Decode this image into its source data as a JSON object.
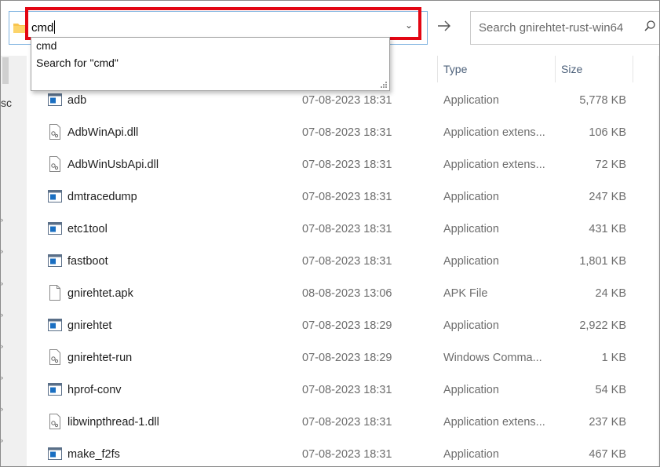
{
  "address_bar": {
    "value": "cmd"
  },
  "search": {
    "placeholder": "Search gnirehtet-rust-win64"
  },
  "suggestions": [
    {
      "label": "cmd"
    },
    {
      "label": "Search for \"cmd\""
    }
  ],
  "nav_pane": {
    "partial_label": "sc"
  },
  "columns": {
    "type": "Type",
    "size": "Size"
  },
  "files": [
    {
      "name": "adb",
      "date": "07-08-2023 18:31",
      "type": "Application",
      "size": "5,778 KB",
      "icon": "application-icon"
    },
    {
      "name": "AdbWinApi.dll",
      "date": "07-08-2023 18:31",
      "type": "Application extens...",
      "size": "106 KB",
      "icon": "dll-file-icon"
    },
    {
      "name": "AdbWinUsbApi.dll",
      "date": "07-08-2023 18:31",
      "type": "Application extens...",
      "size": "72 KB",
      "icon": "dll-file-icon"
    },
    {
      "name": "dmtracedump",
      "date": "07-08-2023 18:31",
      "type": "Application",
      "size": "247 KB",
      "icon": "application-icon"
    },
    {
      "name": "etc1tool",
      "date": "07-08-2023 18:31",
      "type": "Application",
      "size": "431 KB",
      "icon": "application-icon"
    },
    {
      "name": "fastboot",
      "date": "07-08-2023 18:31",
      "type": "Application",
      "size": "1,801 KB",
      "icon": "application-icon"
    },
    {
      "name": "gnirehtet.apk",
      "date": "08-08-2023 13:06",
      "type": "APK File",
      "size": "24 KB",
      "icon": "blank-file-icon"
    },
    {
      "name": "gnirehtet",
      "date": "07-08-2023 18:29",
      "type": "Application",
      "size": "2,922 KB",
      "icon": "application-icon"
    },
    {
      "name": "gnirehtet-run",
      "date": "07-08-2023 18:29",
      "type": "Windows Comma...",
      "size": "1 KB",
      "icon": "cmd-file-icon"
    },
    {
      "name": "hprof-conv",
      "date": "07-08-2023 18:31",
      "type": "Application",
      "size": "54 KB",
      "icon": "application-icon"
    },
    {
      "name": "libwinpthread-1.dll",
      "date": "07-08-2023 18:31",
      "type": "Application extens...",
      "size": "237 KB",
      "icon": "dll-file-icon"
    },
    {
      "name": "make_f2fs",
      "date": "07-08-2023 18:31",
      "type": "Application",
      "size": "467 KB",
      "icon": "application-icon"
    }
  ],
  "colors": {
    "highlight": "#e30613",
    "folder": "#f8c44f",
    "app_icon_blue": "#1a6fc2"
  }
}
